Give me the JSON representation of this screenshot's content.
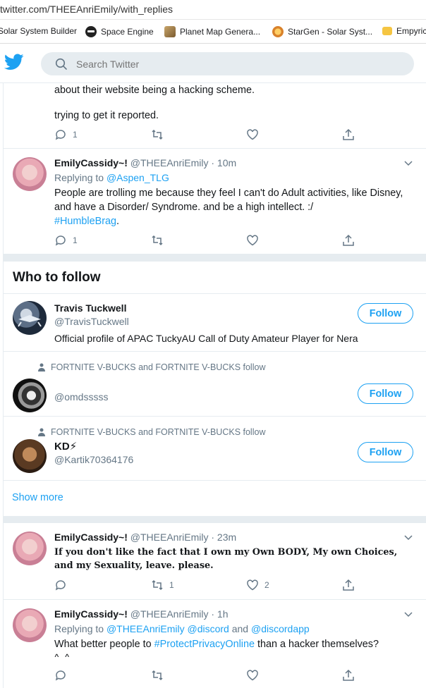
{
  "browser": {
    "url": "twitter.com/THEEAnriEmily/with_replies",
    "bookmarks": [
      {
        "label": "Solar System Builder",
        "icon": "bookmark-icon"
      },
      {
        "label": "Space Engine",
        "icon": "space-engine-icon"
      },
      {
        "label": "Planet Map Genera...",
        "icon": "planet-map-icon"
      },
      {
        "label": "StarGen - Solar Syst...",
        "icon": "stargen-icon"
      },
      {
        "label": "Empyric",
        "icon": "folder-icon"
      }
    ]
  },
  "header": {
    "search_placeholder": "Search Twitter",
    "brand_color": "#1da1f2"
  },
  "tweets_top": [
    {
      "partial": true,
      "lines": [
        "about their website being a hacking scheme.",
        "trying to get it reported."
      ],
      "reply_count": "1",
      "retweet_count": "",
      "like_count": ""
    },
    {
      "name": "EmilyCassidy~!",
      "handle": "@THEEAnriEmily",
      "time": "10m",
      "replying_label": "Replying to",
      "replying_to": [
        "@Aspen_TLG"
      ],
      "text": "People are trolling me because they feel I can't do Adult activities, like Disney, and have a Disorder/ Syndrome.  and be a high intellect. :/",
      "hashtag": "#HumbleBrag",
      "hashtag_suffix": ".",
      "reply_count": "1",
      "retweet_count": "",
      "like_count": ""
    }
  ],
  "who_to_follow": {
    "title": "Who to follow",
    "follow_label": "Follow",
    "show_more": "Show more",
    "accounts": [
      {
        "name": "Travis Tuckwell",
        "handle": "@TravisTuckwell",
        "bio": "Official profile of APAC TuckyAU Call of Duty Amateur Player for Nera",
        "social": ""
      },
      {
        "name": "",
        "handle": "@omdsssss",
        "bio": "",
        "social": "FORTNITE V-BUCKS and FORTNITE V-BUCKS follow"
      },
      {
        "name": "KD⚡",
        "handle": "@Kartik70364176",
        "bio": "",
        "social": "FORTNITE V-BUCKS and FORTNITE V-BUCKS follow"
      }
    ]
  },
  "tweets_bottom": [
    {
      "name": "EmilyCassidy~!",
      "handle": "@THEEAnriEmily",
      "time": "23m",
      "text": "If you don't like the fact that I own my Own BODY, My own Choices, and my Sexuality, leave. please.",
      "reply_count": "",
      "retweet_count": "1",
      "like_count": "2"
    },
    {
      "name": "EmilyCassidy~!",
      "handle": "@THEEAnriEmily",
      "time": "1h",
      "replying_label": "Replying to",
      "replying_to": [
        "@THEEAnriEmily",
        "@discord",
        "@discordapp"
      ],
      "replying_and": "and",
      "text_before": "What better people to",
      "hashtag": "#ProtectPrivacyOnline",
      "text_after": "than a hacker themselves?",
      "text_line2": "^_^~",
      "reply_count": "",
      "retweet_count": "",
      "like_count": ""
    }
  ]
}
